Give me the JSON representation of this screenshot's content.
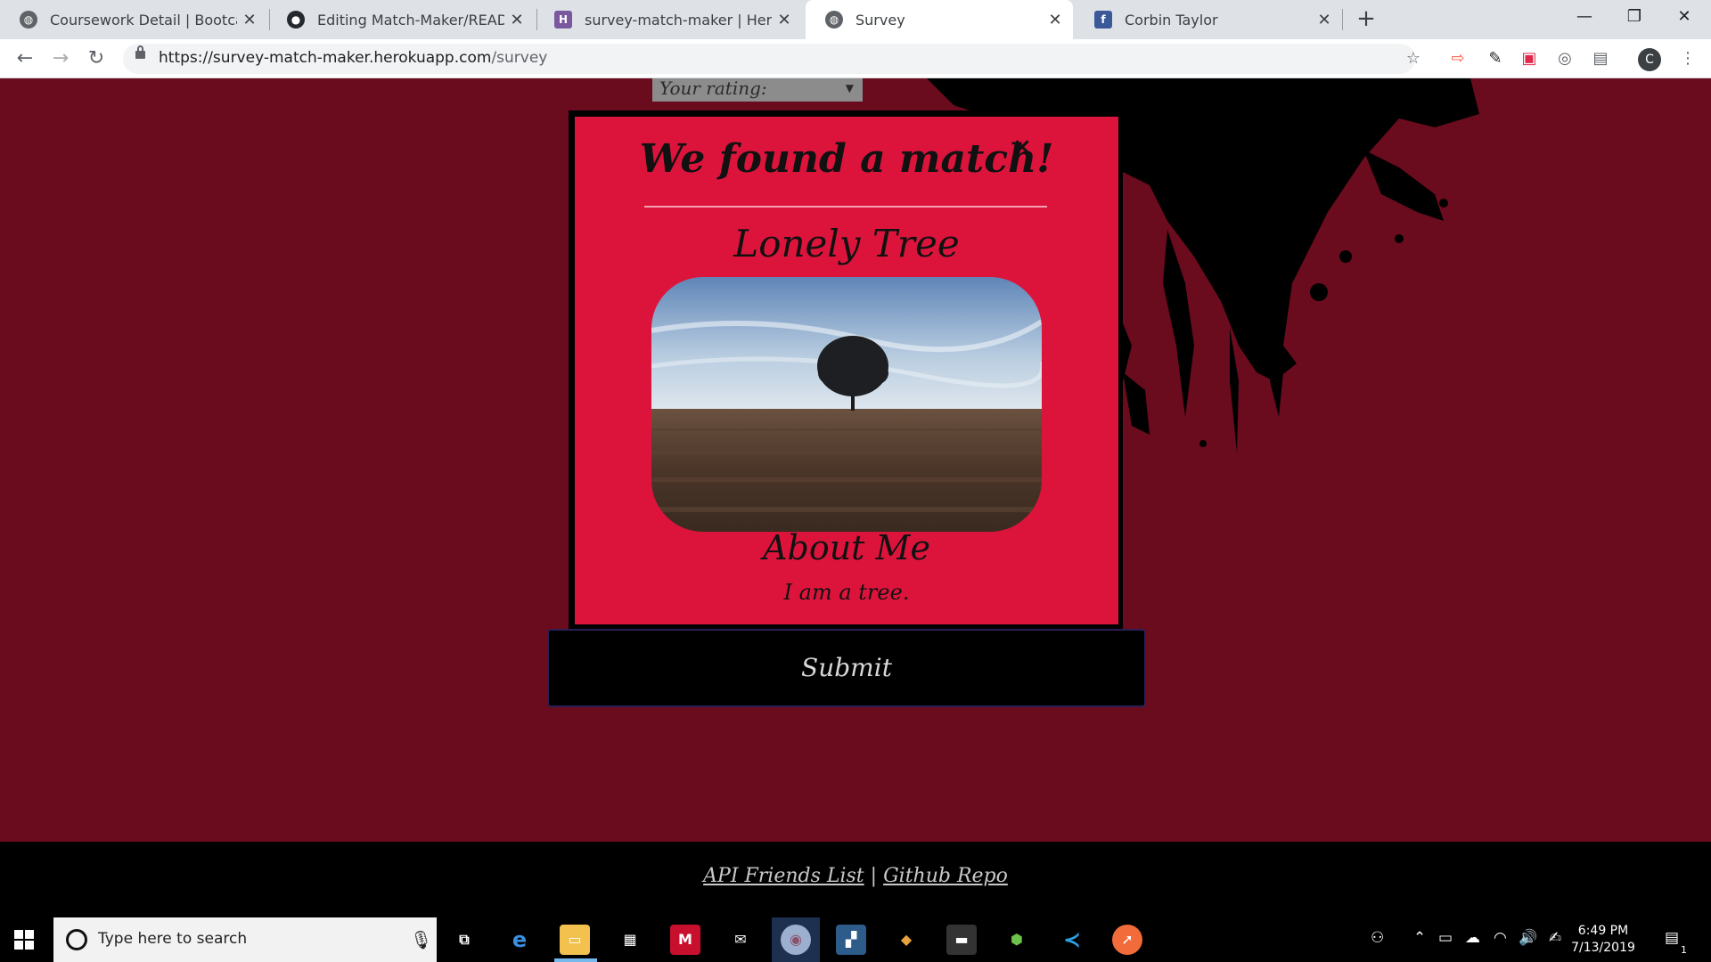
{
  "browser": {
    "tabs": [
      {
        "label": "Coursework Detail | Bootcamp Sp",
        "favicon": "globe-icon",
        "active": false
      },
      {
        "label": "Editing Match-Maker/README.m",
        "favicon": "github-icon",
        "active": false
      },
      {
        "label": "survey-match-maker | Heroku",
        "favicon": "heroku-icon",
        "active": false
      },
      {
        "label": "Survey",
        "favicon": "globe-icon",
        "active": true
      },
      {
        "label": "Corbin Taylor",
        "favicon": "facebook-icon",
        "active": false
      }
    ],
    "close_glyph": "✕",
    "new_tab_glyph": "+",
    "window_controls": {
      "minimize": "—",
      "restore": "❐",
      "close": "✕"
    },
    "url_host": "https://survey-match-maker.herokuapp.com",
    "url_path": "/survey",
    "profile_initial": "C"
  },
  "page": {
    "rating_label": "Your rating:",
    "modal": {
      "title": "We found a match!",
      "close_glyph": "×",
      "match_name": "Lonely Tree",
      "about_heading": "About Me",
      "about_text": "I am a tree."
    },
    "submit_label": "Submit",
    "footer": {
      "link1": "API Friends List",
      "separator": "|",
      "link2": "Github Repo"
    },
    "colors": {
      "background": "#6b0b1e",
      "modal": "#dc143c",
      "splatter": "#000000"
    }
  },
  "taskbar": {
    "search_placeholder": "Type here to search",
    "time": "6:49 PM",
    "date": "7/13/2019",
    "notification_count": "1",
    "apps": [
      "task-view-icon",
      "edge-icon",
      "file-explorer-icon",
      "store-icon",
      "mcafee-icon",
      "mail-icon",
      "chrome-icon",
      "app-icon",
      "git-icon",
      "terminal-icon",
      "node-icon",
      "vscode-icon",
      "postman-icon"
    ]
  }
}
